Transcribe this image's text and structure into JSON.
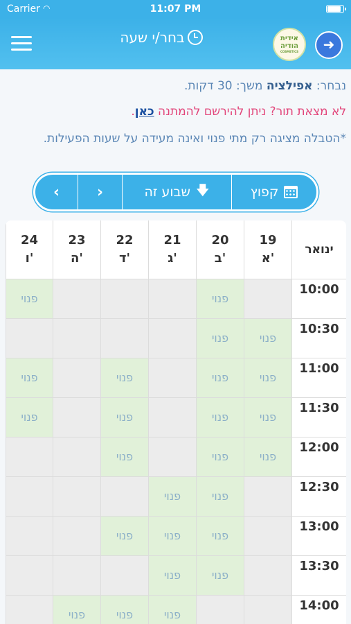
{
  "status_bar": {
    "carrier": "Carrier",
    "time": "11:07 PM"
  },
  "nav": {
    "title": "בחר/י שעה",
    "logo_line1": "אידית",
    "logo_line2": "הודיה",
    "logo_line3": "COSMETICS"
  },
  "info": {
    "selected_prefix": "נבחר: ",
    "selected_service": "אפילציה",
    "selected_suffix": " משך: 30 דקות.",
    "waitlist_text": "לא מצאת תור? ניתן להירשם להמתנה ",
    "waitlist_link": "כאן",
    "waitlist_end": ".",
    "note": "*הטבלה מציגה רק מתי פנוי ואינה מעידה על שעות הפעילות."
  },
  "pager": {
    "jump_label": "קפוץ",
    "this_week_label": "שבוע זה",
    "next_symbol": "›",
    "prev_symbol": "‹"
  },
  "table": {
    "month": "ינואר",
    "days": [
      {
        "num": "19",
        "name": "א'"
      },
      {
        "num": "20",
        "name": "ב'"
      },
      {
        "num": "21",
        "name": "ג'"
      },
      {
        "num": "22",
        "name": "ד'"
      },
      {
        "num": "23",
        "name": "ה'"
      },
      {
        "num": "24",
        "name": "ו'"
      }
    ],
    "free_label": "פנוי",
    "rows": [
      {
        "time": "10:00",
        "slots": [
          false,
          true,
          false,
          false,
          false,
          true
        ]
      },
      {
        "time": "10:30",
        "slots": [
          true,
          true,
          false,
          false,
          false,
          false
        ]
      },
      {
        "time": "11:00",
        "slots": [
          true,
          true,
          false,
          true,
          false,
          true
        ]
      },
      {
        "time": "11:30",
        "slots": [
          true,
          true,
          false,
          true,
          false,
          true
        ]
      },
      {
        "time": "12:00",
        "slots": [
          true,
          true,
          false,
          true,
          false,
          false
        ]
      },
      {
        "time": "12:30",
        "slots": [
          false,
          true,
          true,
          false,
          false,
          false
        ]
      },
      {
        "time": "13:00",
        "slots": [
          false,
          true,
          true,
          true,
          false,
          false
        ]
      },
      {
        "time": "13:30",
        "slots": [
          false,
          true,
          true,
          false,
          false,
          false
        ]
      },
      {
        "time": "14:00",
        "slots": [
          false,
          false,
          true,
          true,
          true,
          false
        ]
      }
    ]
  },
  "colors": {
    "header": "#3cb1e8",
    "free_cell": "#e1f1d9",
    "busy_cell": "#ececec",
    "link_pink": "#e2457a"
  }
}
